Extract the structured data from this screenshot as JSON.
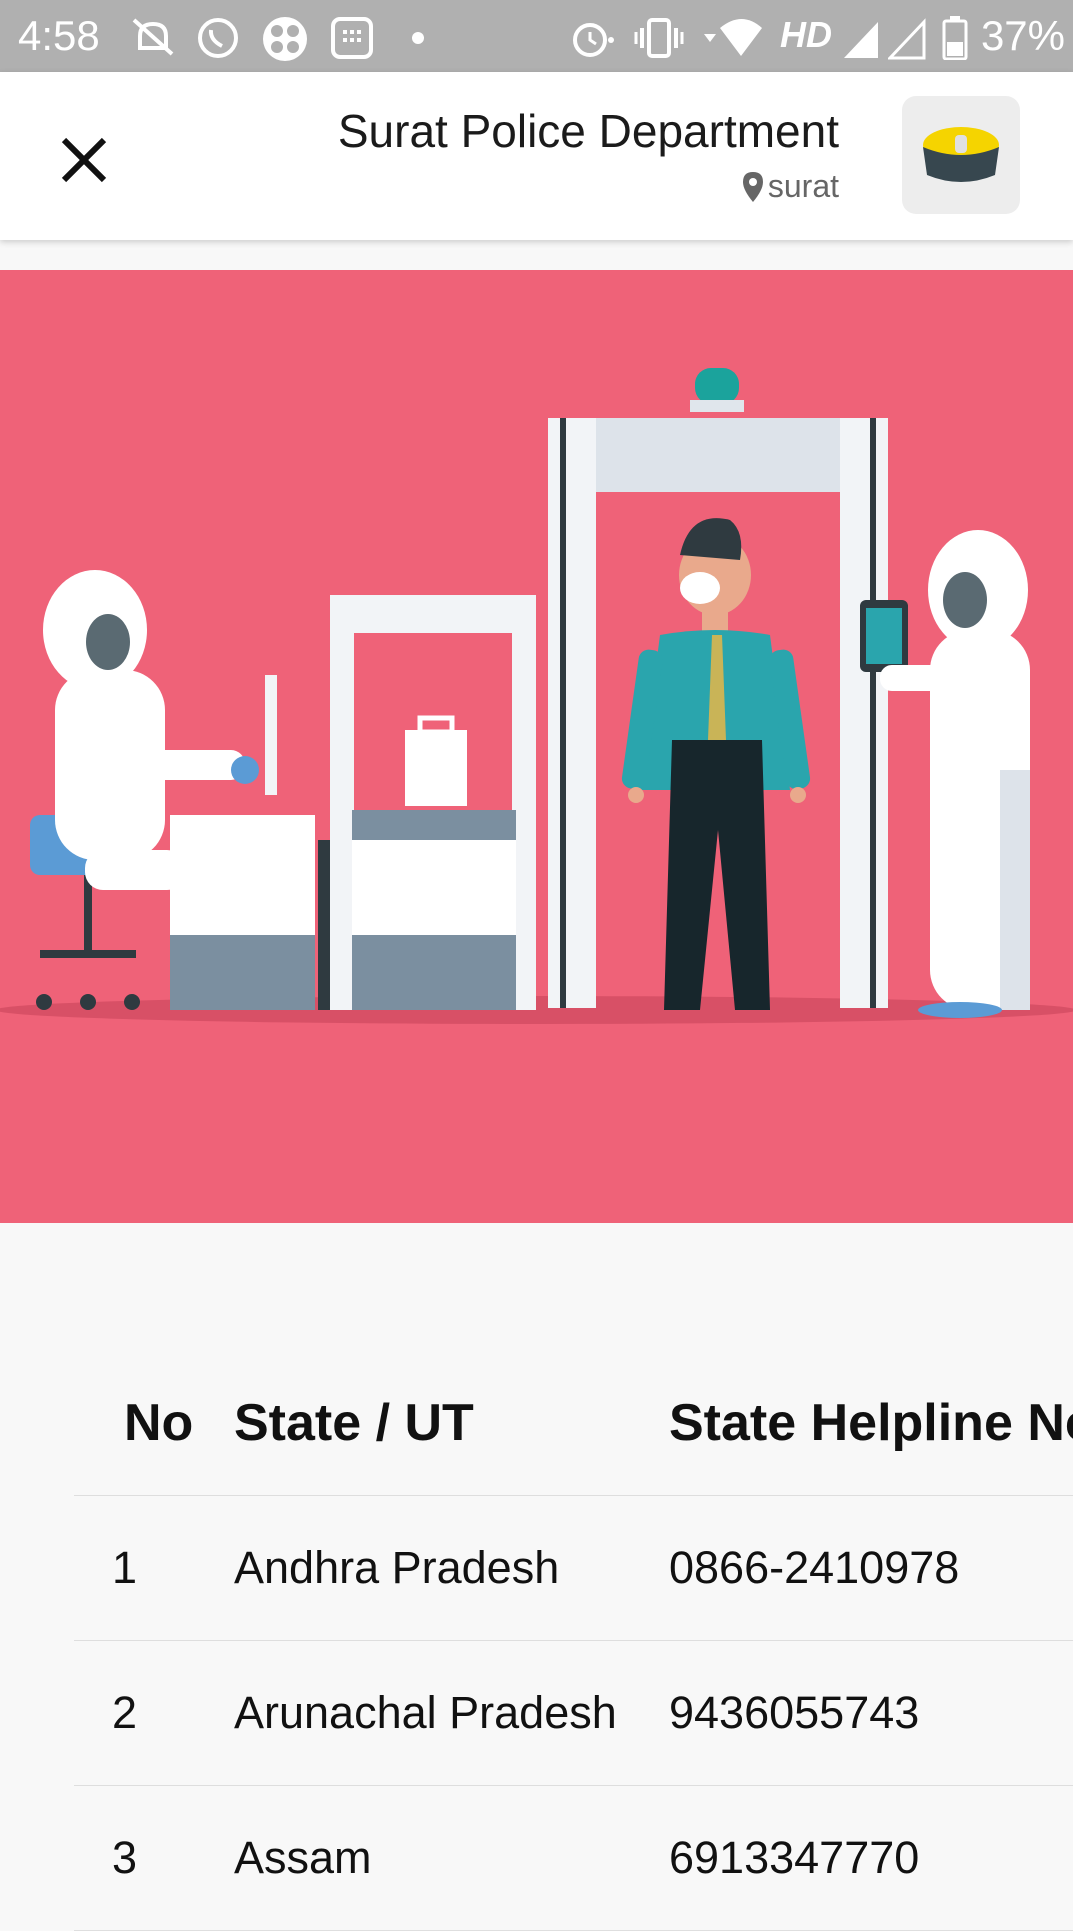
{
  "status_bar": {
    "time": "4:58",
    "network": "HD",
    "battery": "37%",
    "icons": [
      "notifications-off-icon",
      "whatsapp-icon",
      "app-icon",
      "calendar-icon",
      "dot-icon",
      "alarm-icon",
      "vibrate-icon",
      "wifi-icon",
      "signal-icon",
      "signal-empty-icon",
      "battery-icon"
    ]
  },
  "header": {
    "title": "Surat Police Department",
    "location": "surat",
    "avatar_icon": "police-cap-icon"
  },
  "banner": {
    "illustration": "airport-security-screening-illustration",
    "background": "#ef6278"
  },
  "table": {
    "columns": [
      "No",
      "State / UT",
      "State Helpline No"
    ],
    "rows": [
      {
        "no": "1",
        "state": "Andhra Pradesh",
        "phone": "0866-2410978"
      },
      {
        "no": "2",
        "state": "Arunachal Pradesh",
        "phone": "9436055743"
      },
      {
        "no": "3",
        "state": "Assam",
        "phone": "6913347770"
      }
    ]
  }
}
